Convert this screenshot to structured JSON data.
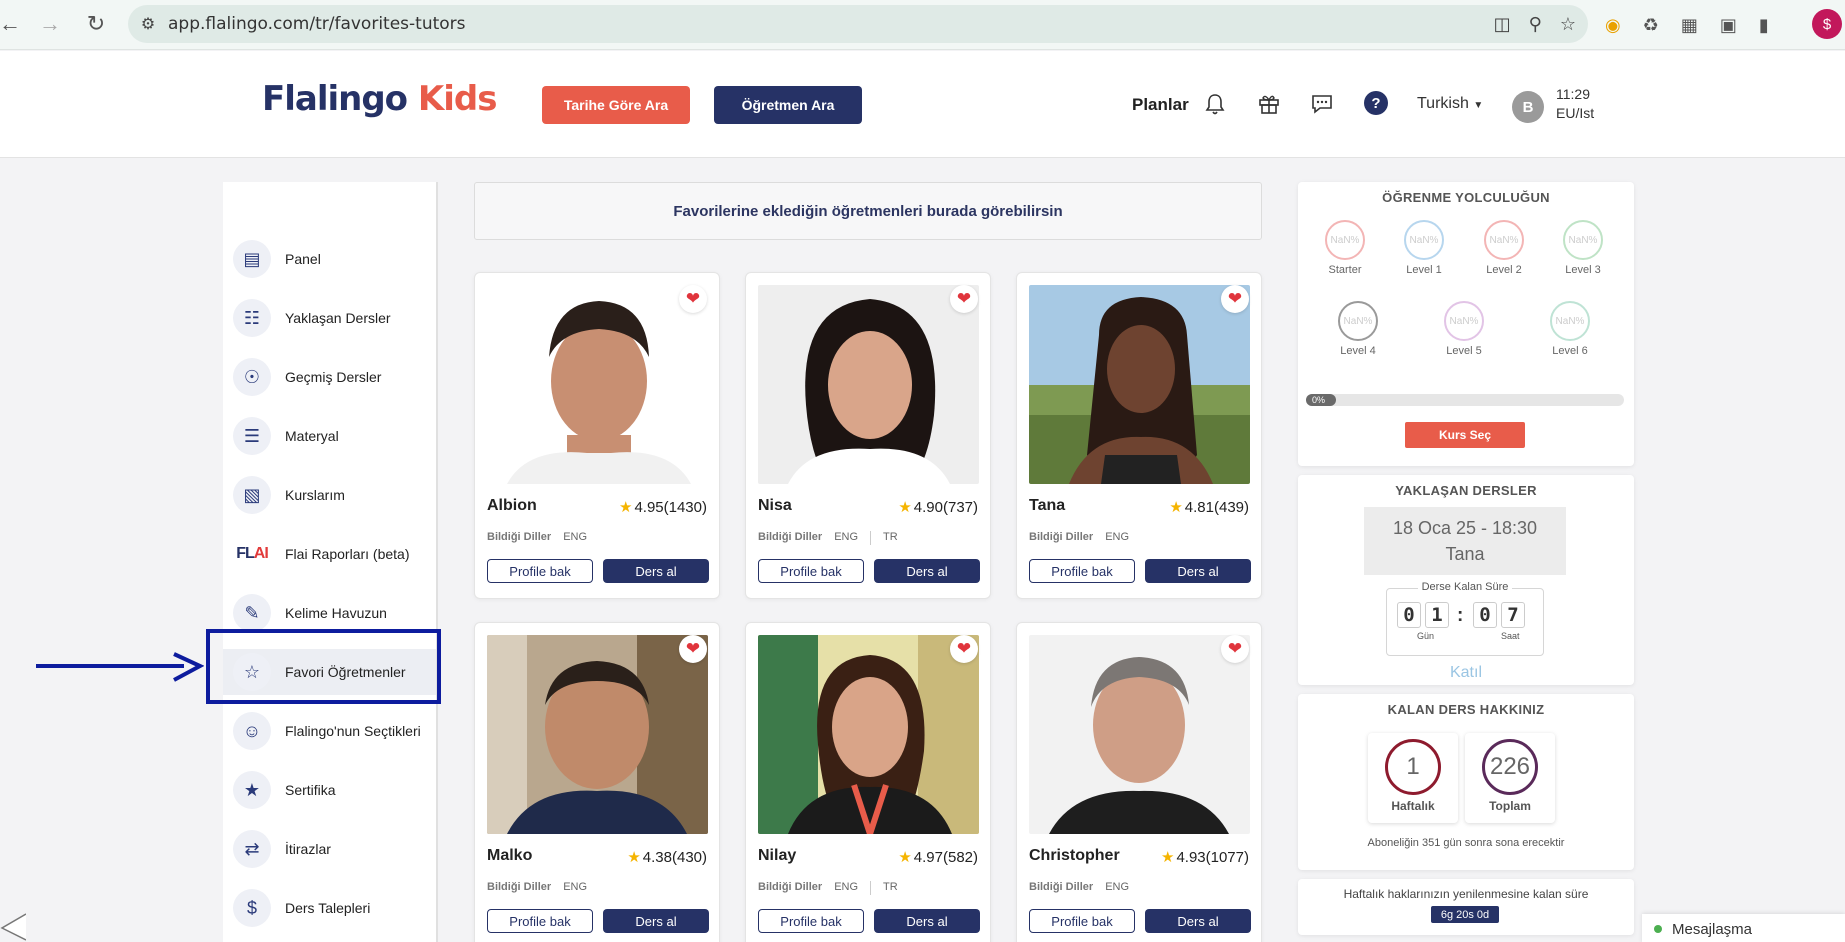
{
  "browser": {
    "url": "app.flalingo.com/tr/favorites-tutors"
  },
  "header": {
    "logo_part1": "Flalingo",
    "logo_part2": "Kids",
    "search_by_date": "Tarihe Göre Ara",
    "search_teacher": "Öğretmen Ara",
    "plans": "Planlar",
    "language": "Turkish",
    "avatar_letter": "B",
    "time": "11:29",
    "timezone": "EU/Ist"
  },
  "sidebar": {
    "items": [
      {
        "label": "Panel",
        "icon": "notebook-icon"
      },
      {
        "label": "Yaklaşan Dersler",
        "icon": "upcoming-lessons-icon"
      },
      {
        "label": "Geçmiş Dersler",
        "icon": "globe-icon"
      },
      {
        "label": "Materyal",
        "icon": "document-icon"
      },
      {
        "label": "Kurslarım",
        "icon": "monitor-icon"
      },
      {
        "label": "Flai Raporları (beta)",
        "icon": "flai-logo-icon"
      },
      {
        "label": "Kelime Havuzun",
        "icon": "vocabulary-icon"
      },
      {
        "label": "Favori Öğretmenler",
        "icon": "star-bookmark-icon"
      },
      {
        "label": "Flalingo'nun Seçtikleri",
        "icon": "group-icon"
      },
      {
        "label": "Sertifika",
        "icon": "certificate-icon"
      },
      {
        "label": "İtirazlar",
        "icon": "objection-icon"
      },
      {
        "label": "Ders Talepleri",
        "icon": "lesson-request-icon"
      }
    ]
  },
  "main": {
    "notice": "Favorilerine eklediğin öğretmenleri burada görebilirsin",
    "langs_label": "Bildiği Diller",
    "profile_label": "Profile bak",
    "lesson_label": "Ders al",
    "tutors": [
      {
        "name": "Albion",
        "rating": "4.95(1430)",
        "langs": [
          "ENG"
        ]
      },
      {
        "name": "Nisa",
        "rating": "4.90(737)",
        "langs": [
          "ENG",
          "TR"
        ]
      },
      {
        "name": "Tana",
        "rating": "4.81(439)",
        "langs": [
          "ENG"
        ]
      },
      {
        "name": "Malko",
        "rating": "4.38(430)",
        "langs": [
          "ENG"
        ]
      },
      {
        "name": "Nilay",
        "rating": "4.97(582)",
        "langs": [
          "ENG",
          "TR"
        ]
      },
      {
        "name": "Christopher",
        "rating": "4.93(1077)",
        "langs": [
          "ENG"
        ]
      }
    ]
  },
  "journey": {
    "title": "ÖĞRENME YOLCULUĞUN",
    "levels": [
      {
        "label": "Starter",
        "value": "NaN%",
        "color": "#f3b5b5"
      },
      {
        "label": "Level 1",
        "value": "NaN%",
        "color": "#b7d6ee"
      },
      {
        "label": "Level 2",
        "value": "NaN%",
        "color": "#f3b5b5"
      },
      {
        "label": "Level 3",
        "value": "NaN%",
        "color": "#bfe3c6"
      },
      {
        "label": "Level 4",
        "value": "NaN%",
        "color": "#9a9a9a"
      },
      {
        "label": "Level 5",
        "value": "NaN%",
        "color": "#e2c4e6"
      },
      {
        "label": "Level 6",
        "value": "NaN%",
        "color": "#bfe3d5"
      }
    ],
    "progress_text": "0%",
    "progress_fraction": 0,
    "course_button": "Kurs Seç"
  },
  "upcoming": {
    "title": "YAKLAŞAN DERSLER",
    "datetime": "18 Oca 25 - 18:30",
    "tutor": "Tana",
    "remaining_title": "Derse Kalan Süre",
    "days": [
      "0",
      "1"
    ],
    "hours": [
      "0",
      "7"
    ],
    "days_label": "Gün",
    "hours_label": "Saat",
    "join": "Katıl"
  },
  "credits": {
    "title": "KALAN DERS HAKKINIZ",
    "weekly": "1",
    "weekly_label": "Haftalık",
    "total": "226",
    "total_label": "Toplam",
    "note": "Aboneliğin 351 gün sonra sona erecektir"
  },
  "renewal": {
    "text": "Haftalık haklarınızın yenilenmesine kalan süre",
    "badge": "6g 20s 0d"
  },
  "chat": {
    "label": "Mesajlaşma"
  },
  "colors": {
    "primary": "#263266",
    "accent": "#e85c4a",
    "highlight": "#0d1c9e"
  }
}
